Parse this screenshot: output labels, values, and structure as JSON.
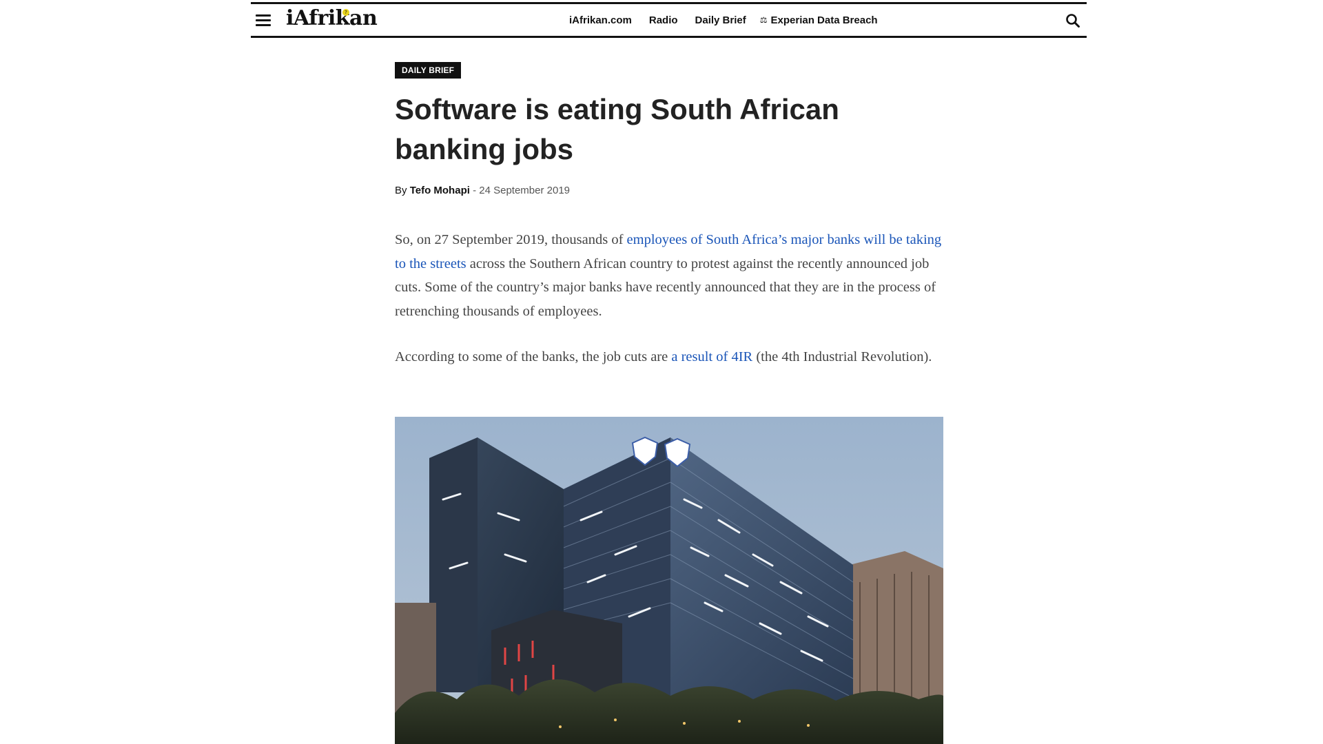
{
  "header": {
    "logo_text": "iAfrikan",
    "nav": [
      {
        "icon": "globe-icon",
        "glyph": "",
        "label": "iAfrikan.com"
      },
      {
        "icon": "microphone-icon",
        "glyph": "",
        "label": "Radio"
      },
      {
        "icon": "newspaper-icon",
        "glyph": "",
        "label": "Daily Brief"
      },
      {
        "icon": "scales-icon",
        "glyph": "⚖",
        "label": "Experian Data Breach"
      }
    ]
  },
  "article": {
    "category": "Daily Brief",
    "title": "Software is eating South African banking jobs",
    "byline": {
      "prefix": "By",
      "author": "Tefo Mohapi",
      "separator": "-",
      "date": "24 September 2019"
    },
    "paragraph1": {
      "before": "So, on 27 September 2019, thousands of ",
      "link": "employees of South Africa’s major banks will be taking to the streets",
      "after": " across the Southern African country to protest against the recently announced job cuts. Some of the country’s major banks have recently announced that they are in the process of retrenching thousands of employees."
    },
    "paragraph2": {
      "before": "According to some of the banks, the job cuts are ",
      "link": "a result of 4IR",
      "after": " (the 4th Industrial Revolution)."
    }
  },
  "colors": {
    "link": "#1a55b8",
    "text": "#444444",
    "category_bg": "#111111",
    "logo_accent": "#e7d31c"
  }
}
